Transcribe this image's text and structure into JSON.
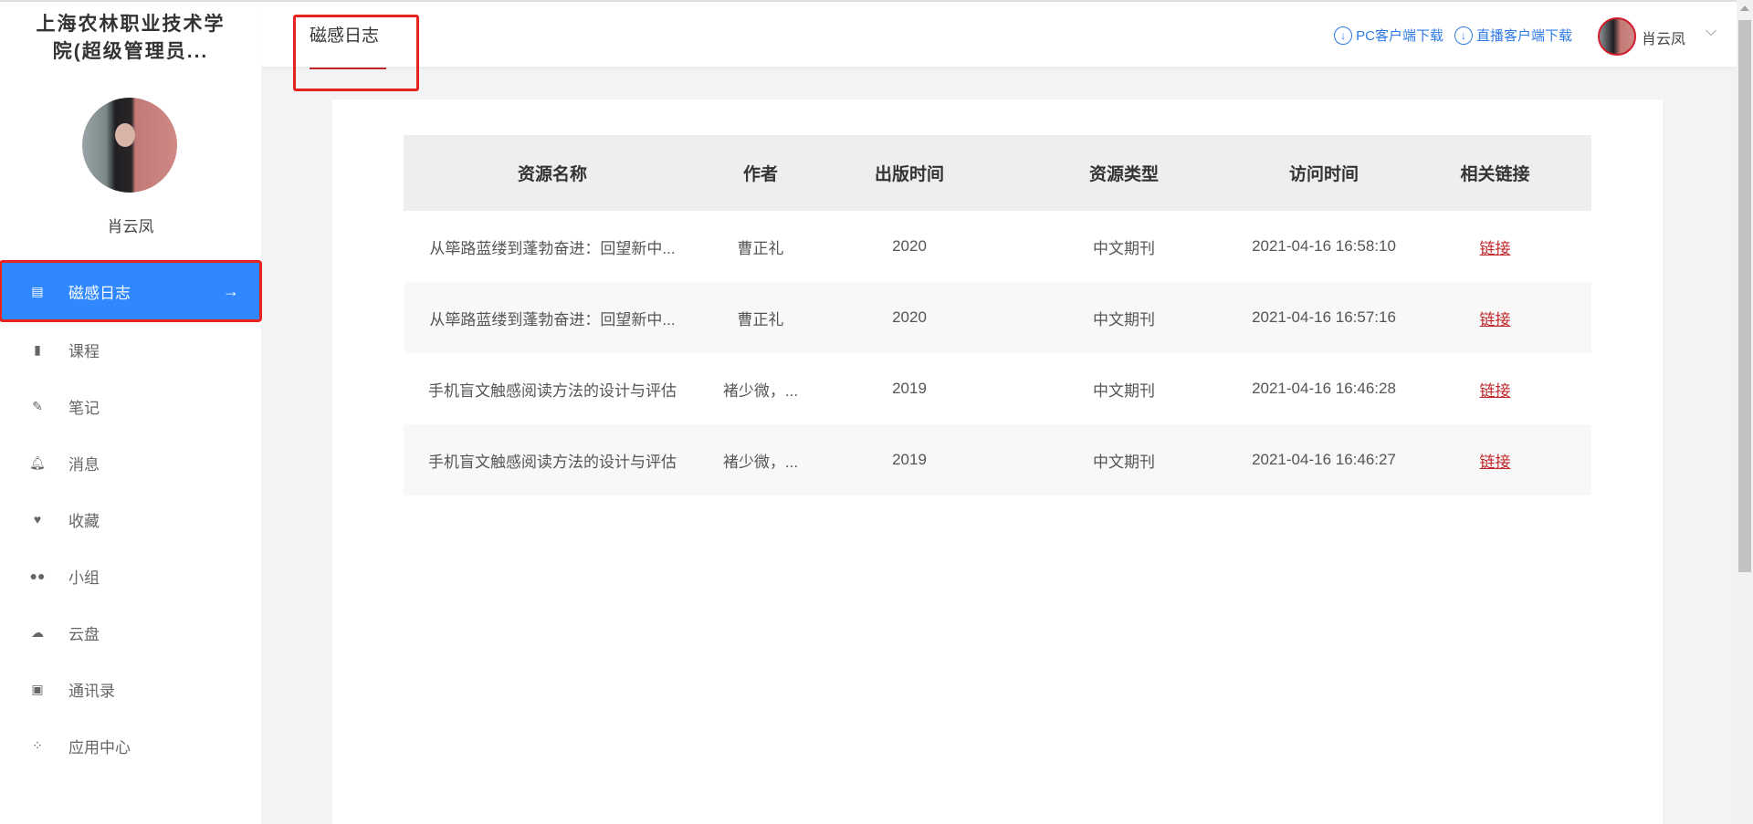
{
  "sidebar": {
    "org_title_line1": "上海农林职业技术学",
    "org_title_line2": "院(超级管理员...",
    "user_name": "肖云凤",
    "items": [
      {
        "label": "磁感日志",
        "icon": "document-icon"
      },
      {
        "label": "课程",
        "icon": "book-icon"
      },
      {
        "label": "笔记",
        "icon": "pencil-icon"
      },
      {
        "label": "消息",
        "icon": "bell-icon"
      },
      {
        "label": "收藏",
        "icon": "heart-icon"
      },
      {
        "label": "小组",
        "icon": "group-icon"
      },
      {
        "label": "云盘",
        "icon": "cloud-upload-icon"
      },
      {
        "label": "通讯录",
        "icon": "contacts-icon"
      },
      {
        "label": "应用中心",
        "icon": "apps-icon"
      }
    ]
  },
  "header": {
    "tab": "磁感日志",
    "pc_download": "PC客户端下载",
    "live_download": "直播客户端下载",
    "user_name": "肖云凤"
  },
  "table": {
    "columns": [
      "资源名称",
      "作者",
      "出版时间",
      "资源类型",
      "访问时间",
      "相关链接"
    ],
    "rows": [
      [
        "从筚路蓝缕到蓬勃奋进：回望新中...",
        "曹正礼",
        "2020",
        "中文期刊",
        "2021-04-16 16:58:10",
        "链接"
      ],
      [
        "从筚路蓝缕到蓬勃奋进：回望新中...",
        "曹正礼",
        "2020",
        "中文期刊",
        "2021-04-16 16:57:16",
        "链接"
      ],
      [
        "手机盲文触感阅读方法的设计与评估",
        "褚少微，...",
        "2019",
        "中文期刊",
        "2021-04-16 16:46:28",
        "链接"
      ],
      [
        "手机盲文触感阅读方法的设计与评估",
        "褚少微，...",
        "2019",
        "中文期刊",
        "2021-04-16 16:46:27",
        "链接"
      ]
    ]
  },
  "colors": {
    "accent": "#2f88ff",
    "highlight": "#e8231e",
    "link": "#c0262a"
  }
}
